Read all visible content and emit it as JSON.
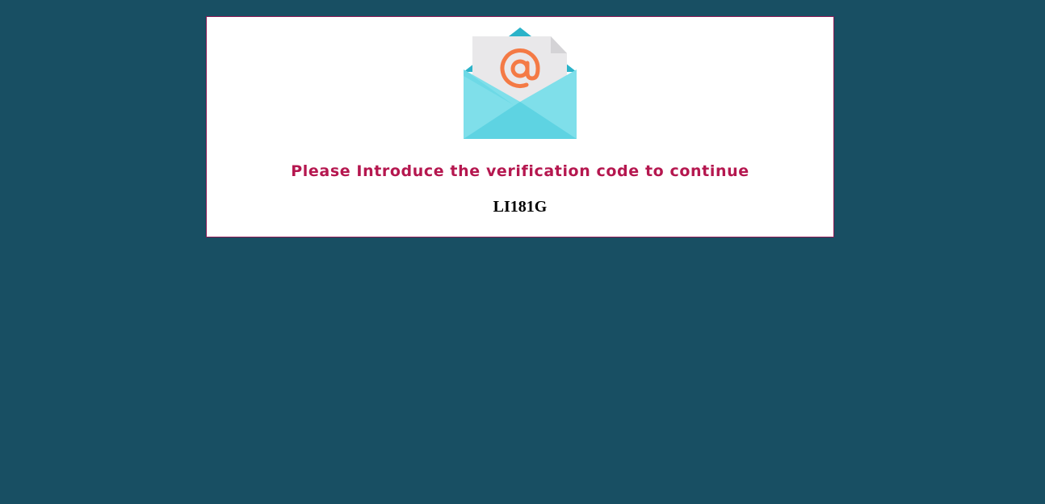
{
  "dialog": {
    "icon": "envelope-email-icon",
    "message": "Please Introduce the verification code to continue",
    "code": "LI181G"
  },
  "colors": {
    "background": "#184f63",
    "card": "#ffffff",
    "card_border": "#8b1a55",
    "message_text": "#b5174f",
    "code_text": "#000000",
    "envelope_light": "#7fdfea",
    "envelope_dark": "#5ed3e2",
    "envelope_flap": "#2bb3c9",
    "paper": "#e9e8ea",
    "at_symbol": "#f47a45"
  }
}
